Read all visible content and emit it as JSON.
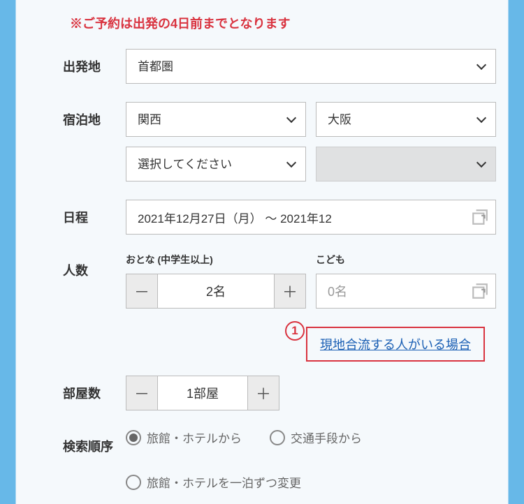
{
  "notice": "※ご予約は出発の4日前までとなります",
  "departure": {
    "label": "出発地",
    "value": "首都圏"
  },
  "stay": {
    "label": "宿泊地",
    "region": "関西",
    "city": "大阪",
    "sub": "選択してください"
  },
  "schedule": {
    "label": "日程",
    "value": "2021年12月27日（月） ～ 2021年12"
  },
  "people": {
    "label": "人数",
    "adult_label": "おとな (中学生以上)",
    "adult_value": "2名",
    "child_label": "こども",
    "child_value": "0名"
  },
  "annotation": {
    "number": "1",
    "link_text": "現地合流する人がいる場合"
  },
  "rooms": {
    "label": "部屋数",
    "value": "1部屋"
  },
  "search_order": {
    "label": "検索順序",
    "options": [
      "旅館・ホテルから",
      "交通手段から",
      "旅館・ホテルを一泊ずつ変更"
    ],
    "selected_index": 0
  }
}
